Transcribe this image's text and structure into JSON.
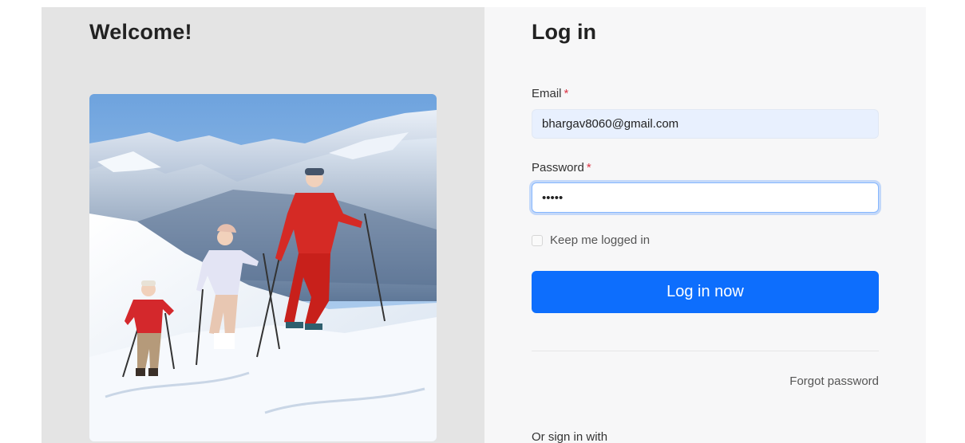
{
  "welcome": {
    "title": "Welcome!"
  },
  "login": {
    "title": "Log in",
    "email": {
      "label": "Email",
      "required_mark": "*",
      "value": "bhargav8060@gmail.com"
    },
    "password": {
      "label": "Password",
      "required_mark": "*",
      "value": "•••••"
    },
    "keep_logged_in": {
      "label": "Keep me logged in",
      "checked": false
    },
    "submit_label": "Log in now",
    "forgot_password": "Forgot password",
    "or_sign_in_with": "Or sign in with"
  },
  "colors": {
    "primary": "#0d6efd",
    "left_panel_bg": "#e4e4e4",
    "right_panel_bg": "#f7f7f8",
    "autofill_bg": "#e8f0fe",
    "required": "#dc3545"
  }
}
